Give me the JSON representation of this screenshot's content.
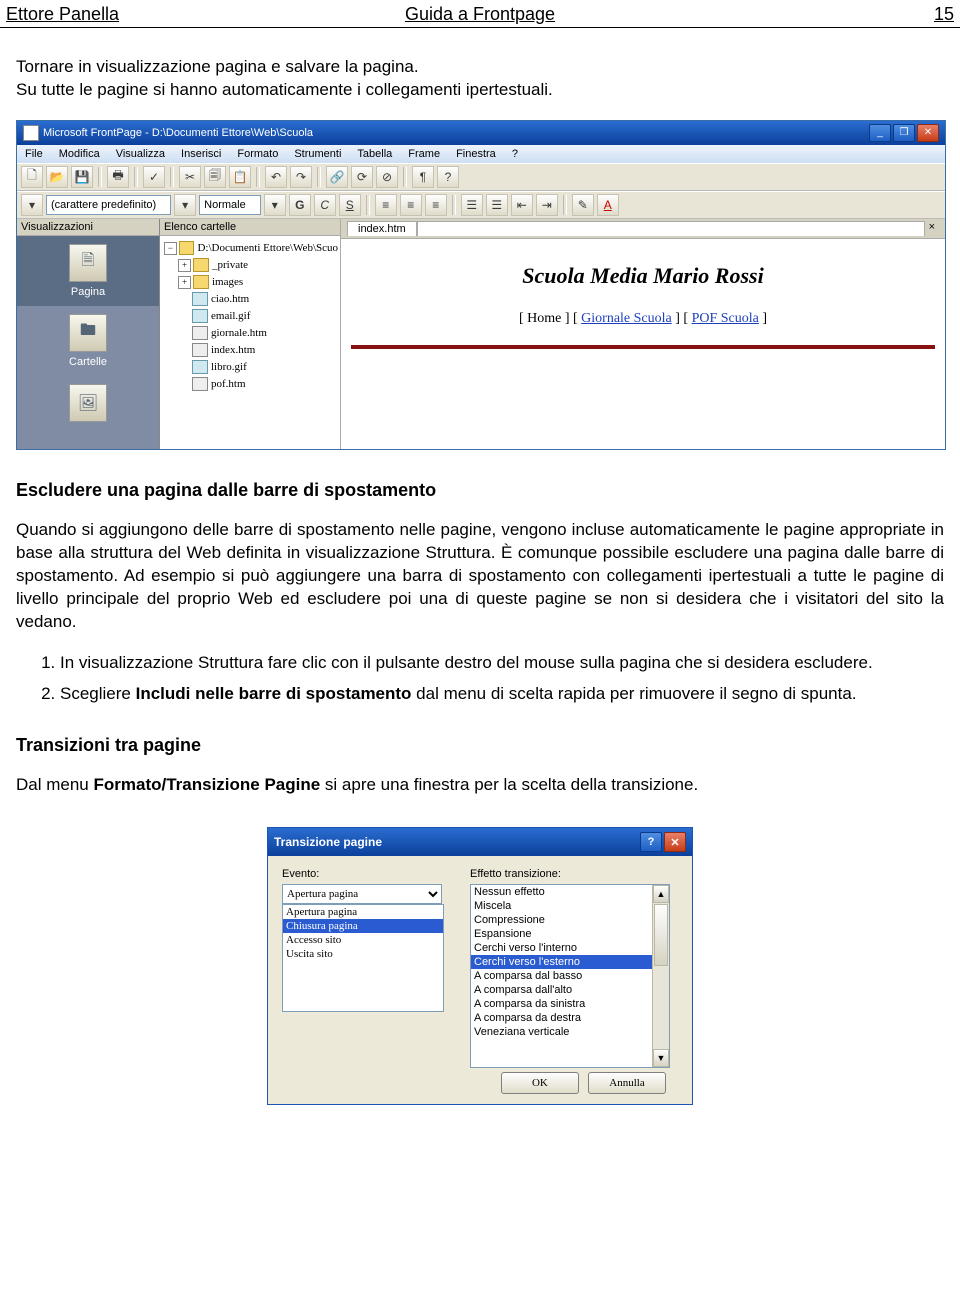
{
  "header": {
    "author": "Ettore Panella",
    "title": "Guida a Frontpage",
    "page": "15"
  },
  "intro": {
    "p1": "Tornare in visualizzazione pagina e salvare la pagina.",
    "p2": "Su tutte le pagine si hanno automaticamente i collegamenti ipertestuali."
  },
  "fp": {
    "winTitle": "Microsoft FrontPage - D:\\Documenti Ettore\\Web\\Scuola",
    "menu": [
      "File",
      "Modifica",
      "Visualizza",
      "Inserisci",
      "Formato",
      "Strumenti",
      "Tabella",
      "Frame",
      "Finestra",
      "?"
    ],
    "fontBox": "(carattere predefinito)",
    "styleBox": "Normale",
    "bold": "G",
    "italic": "C",
    "under": "S",
    "visualHeader": "Visualizzazioni",
    "visItems": [
      "Pagina",
      "Cartelle"
    ],
    "foldersHeader": "Elenco cartelle",
    "treeRoot": "D:\\Documenti Ettore\\Web\\Scuo",
    "tree": [
      {
        "t": "folder",
        "name": "_private"
      },
      {
        "t": "folder",
        "name": "images"
      },
      {
        "t": "gif",
        "name": "ciao.htm"
      },
      {
        "t": "gif",
        "name": "email.gif"
      },
      {
        "t": "htm",
        "name": "giornale.htm"
      },
      {
        "t": "htm",
        "name": "index.htm"
      },
      {
        "t": "gif",
        "name": "libro.gif"
      },
      {
        "t": "htm",
        "name": "pof.htm"
      }
    ],
    "tabLabel": "index.htm",
    "pageTitle": "Scuola Media Mario Rossi",
    "navHome": "Home",
    "navG": "Giornale Scuola",
    "navP": "POF Scuola"
  },
  "section1": {
    "heading": "Escludere una pagina dalle barre di spostamento",
    "body": "Quando si aggiungono delle barre di spostamento nelle pagine, vengono incluse automaticamente le pagine appropriate in base alla struttura del Web definita in visualizzazione Struttura. È comunque possibile escludere una pagina dalle barre di spostamento. Ad esempio si può aggiungere una barra di spostamento con collegamenti ipertestuali a tutte le pagine di livello principale del proprio Web ed escludere poi una di queste pagine se non si desidera che i visitatori del sito la vedano.",
    "step1": "In visualizzazione Struttura fare clic con il pulsante destro del mouse sulla pagina che si desidera escludere.",
    "step2a": "Scegliere ",
    "step2b": "Includi nelle barre di spostamento",
    "step2c": " dal menu di scelta rapida per rimuovere il segno di spunta."
  },
  "section2": {
    "heading": "Transizioni tra pagine",
    "line_a": "Dal menu ",
    "line_b": "Formato/Transizione Pagine",
    "line_c": " si apre una finestra per la scelta della transizione."
  },
  "dlg": {
    "title": "Transizione pagine",
    "eventoLabel": "Evento:",
    "eventoSel": "Apertura pagina",
    "eventoList": [
      "Apertura pagina",
      "Chiusura pagina",
      "Accesso sito",
      "Uscita sito"
    ],
    "eventoSelIdx": 1,
    "effettoLabel": "Effetto transizione:",
    "effettoList": [
      "Nessun effetto",
      "Miscela",
      "Compressione",
      "Espansione",
      "Cerchi verso l'interno",
      "Cerchi verso l'esterno",
      "A comparsa dal basso",
      "A comparsa dall'alto",
      "A comparsa da sinistra",
      "A comparsa da destra",
      "Veneziana verticale"
    ],
    "effettoSelIdx": 5,
    "ok": "OK",
    "cancel": "Annulla"
  }
}
